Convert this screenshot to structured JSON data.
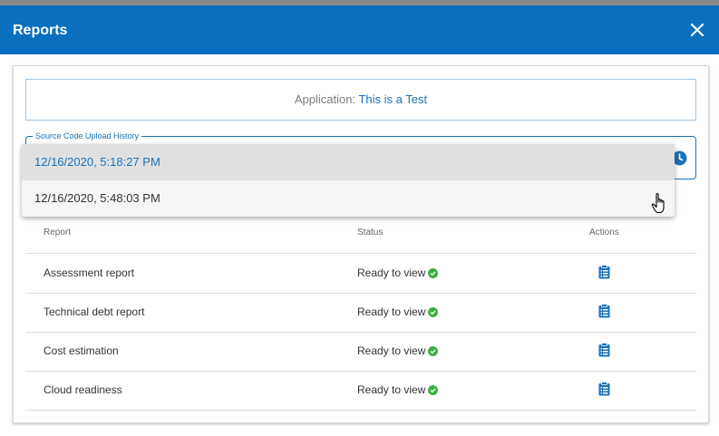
{
  "modal": {
    "title": "Reports",
    "header_color": "#0a6fbe"
  },
  "application": {
    "label": "Application:",
    "value": "This is a Test"
  },
  "history_select": {
    "legend": "Source Code Upload History",
    "icon": "clock-icon",
    "options": [
      {
        "label": "12/16/2020, 5:18:27 PM",
        "selected": true
      },
      {
        "label": "12/16/2020, 5:48:03 PM",
        "selected": false
      }
    ]
  },
  "table": {
    "columns": [
      "Report",
      "Status",
      "Actions"
    ],
    "rows": [
      {
        "report": "Assessment report",
        "status": "Ready to view"
      },
      {
        "report": "Technical debt report",
        "status": "Ready to view"
      },
      {
        "report": "Cost estimation",
        "status": "Ready to view"
      },
      {
        "report": "Cloud readiness",
        "status": "Ready to view"
      }
    ],
    "status_icon": "check-circle-icon",
    "status_color": "#3cb043",
    "action_icon": "clipboard-list-icon"
  },
  "icons": {
    "close": "close-icon",
    "cursor": "hand-pointer-icon"
  },
  "colors": {
    "accent": "#1b72b8"
  }
}
